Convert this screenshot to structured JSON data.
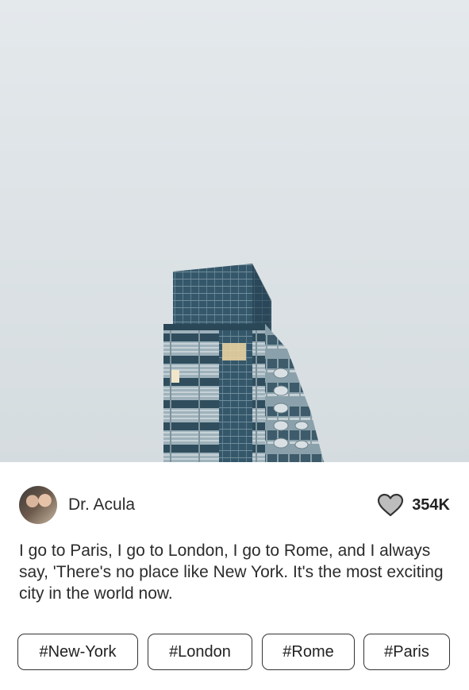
{
  "post": {
    "photo_alt": "skyscraper against pale sky",
    "author": {
      "name": "Dr. Acula"
    },
    "likes": {
      "count": "354K",
      "icon": "heart-icon"
    },
    "caption": "I go to Paris, I go to London, I go to Rome, and I always say, 'There's no place like New York. It's the most exciting city in the world now.",
    "tags": [
      "#New-York",
      "#London",
      "#Rome",
      "#Paris"
    ]
  },
  "colors": {
    "sky": "#dde3e6",
    "building_glass": "#2e4d5e",
    "text": "#2c2c2c",
    "heart_fill": "#bdbdbd",
    "tag_border": "#333333"
  }
}
